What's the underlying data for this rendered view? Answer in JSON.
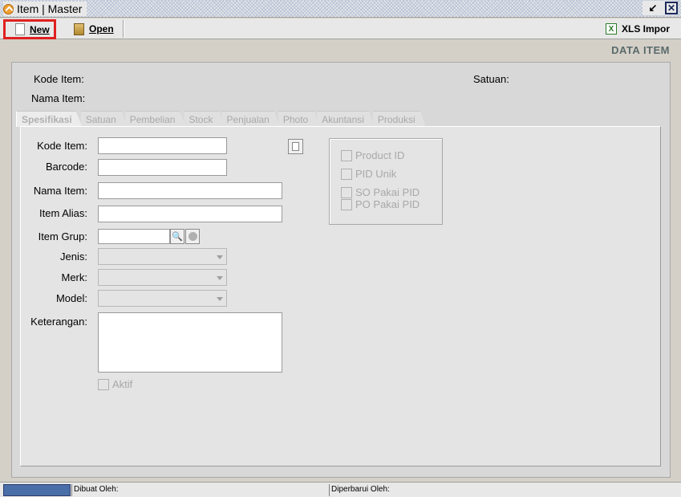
{
  "window": {
    "title": "Item | Master"
  },
  "toolbar": {
    "new_label": "New",
    "open_label": "Open",
    "xls_label": "XLS Impor"
  },
  "header": {
    "section_title": "DATA ITEM",
    "kode_item_label": "Kode Item:",
    "nama_item_label": "Nama Item:",
    "satuan_label": "Satuan:"
  },
  "tabs": [
    {
      "label": "Spesifikasi"
    },
    {
      "label": "Satuan"
    },
    {
      "label": "Pembelian"
    },
    {
      "label": "Stock"
    },
    {
      "label": "Penjualan"
    },
    {
      "label": "Photo"
    },
    {
      "label": "Akuntansi"
    },
    {
      "label": "Produksi"
    }
  ],
  "form": {
    "kode_item": {
      "label": "Kode Item:",
      "value": ""
    },
    "barcode": {
      "label": "Barcode:",
      "value": ""
    },
    "nama_item": {
      "label": "Nama Item:",
      "value": ""
    },
    "item_alias": {
      "label": "Item Alias:",
      "value": ""
    },
    "item_grup": {
      "label": "Item Grup:",
      "value": ""
    },
    "jenis": {
      "label": "Jenis:",
      "value": ""
    },
    "merk": {
      "label": "Merk:",
      "value": ""
    },
    "model": {
      "label": "Model:",
      "value": ""
    },
    "keterangan": {
      "label": "Keterangan:",
      "value": ""
    },
    "aktif_label": "Aktif"
  },
  "pid_options": [
    {
      "label": "Product ID"
    },
    {
      "label": "PID Unik"
    },
    {
      "label": "SO Pakai PID"
    },
    {
      "label": "PO Pakai PID"
    }
  ],
  "statusbar": {
    "dibuat_oleh": "Dibuat Oleh:",
    "diperbarui_oleh": "Diperbarui Oleh:"
  }
}
